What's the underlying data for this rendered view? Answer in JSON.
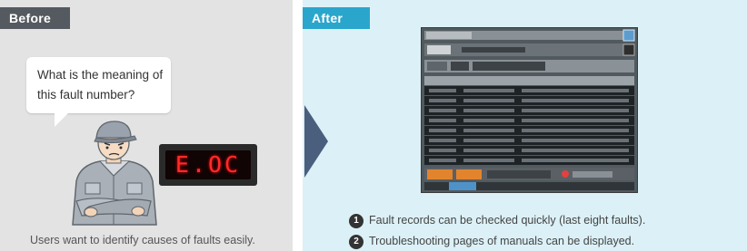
{
  "before": {
    "label": "Before",
    "bubble": "What is the meaning of this fault number?",
    "fault_display": "E.OC 1",
    "caption": "Users want to identify causes of faults easily."
  },
  "after": {
    "label": "After",
    "items": [
      {
        "num": "1",
        "text": "Fault records can be checked quickly (last eight faults)."
      },
      {
        "num": "2",
        "text": "Troubleshooting pages of manuals can be displayed."
      }
    ]
  },
  "colors": {
    "before_bg": "#e3e3e3",
    "after_bg": "#dcf1f7",
    "before_tag": "#555a60",
    "after_tag": "#2aa6cc",
    "arrow": "#4a5e7e",
    "segment_red": "#ff2b2b"
  }
}
